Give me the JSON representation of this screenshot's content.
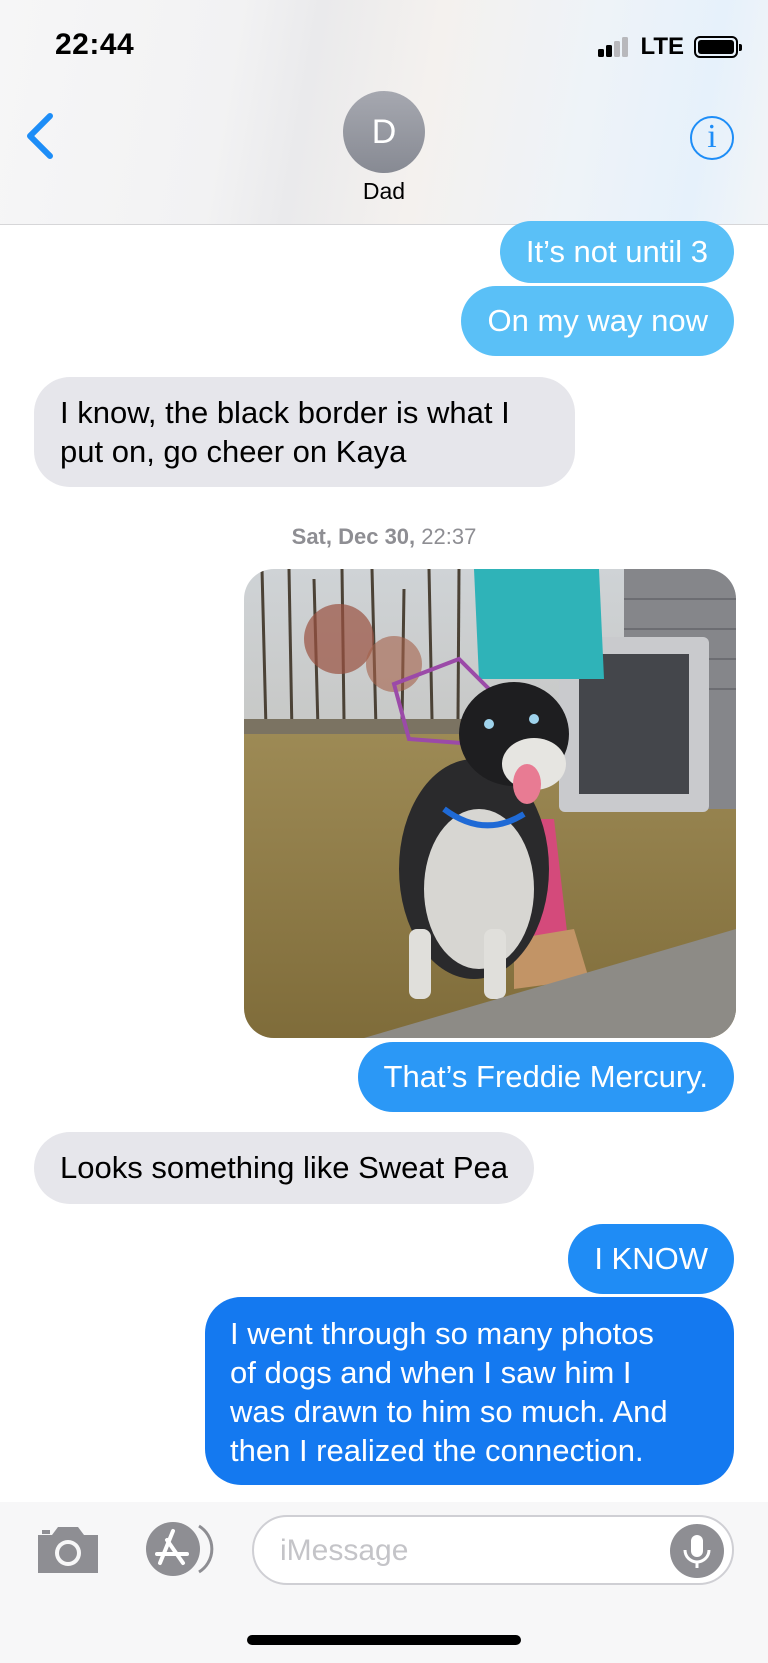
{
  "status_bar": {
    "time": "22:44",
    "network": "LTE"
  },
  "header": {
    "back_icon": "chevron-left-icon",
    "avatar_initial": "D",
    "contact_name": "Dad",
    "info_icon": "info-icon",
    "info_glyph": "i"
  },
  "colors": {
    "accent": "#1d8df7",
    "sent_light": "#5ac0f7",
    "sent_mid": "#2b98f6",
    "sent_deep": "#1479f0",
    "received": "#e6e6eb"
  },
  "messages": [
    {
      "from": "me",
      "text": "It’s not until 3"
    },
    {
      "from": "me",
      "text": "On my way now"
    },
    {
      "from": "dad",
      "lines": [
        "I know, the black border is what I",
        "put on, go cheer on Kaya"
      ]
    },
    {
      "from": "me",
      "text": "That’s Freddie Mercury."
    },
    {
      "from": "dad",
      "text": "Looks something like Sweat Pea"
    },
    {
      "from": "me",
      "text": "I KNOW"
    },
    {
      "from": "me",
      "lines": [
        "I went through so many photos",
        "of dogs and when I saw him I",
        "was drawn to him so much. And",
        "then I realized the connection."
      ]
    }
  ],
  "timestamp": {
    "day": "Sat, Dec 30,",
    "time": "22:37"
  },
  "photo": {
    "alt_icon": "dog-photo"
  },
  "composer": {
    "placeholder": "iMessage",
    "camera_icon": "camera-icon",
    "apps_icon": "app-store-icon",
    "mic_icon": "microphone-icon"
  }
}
